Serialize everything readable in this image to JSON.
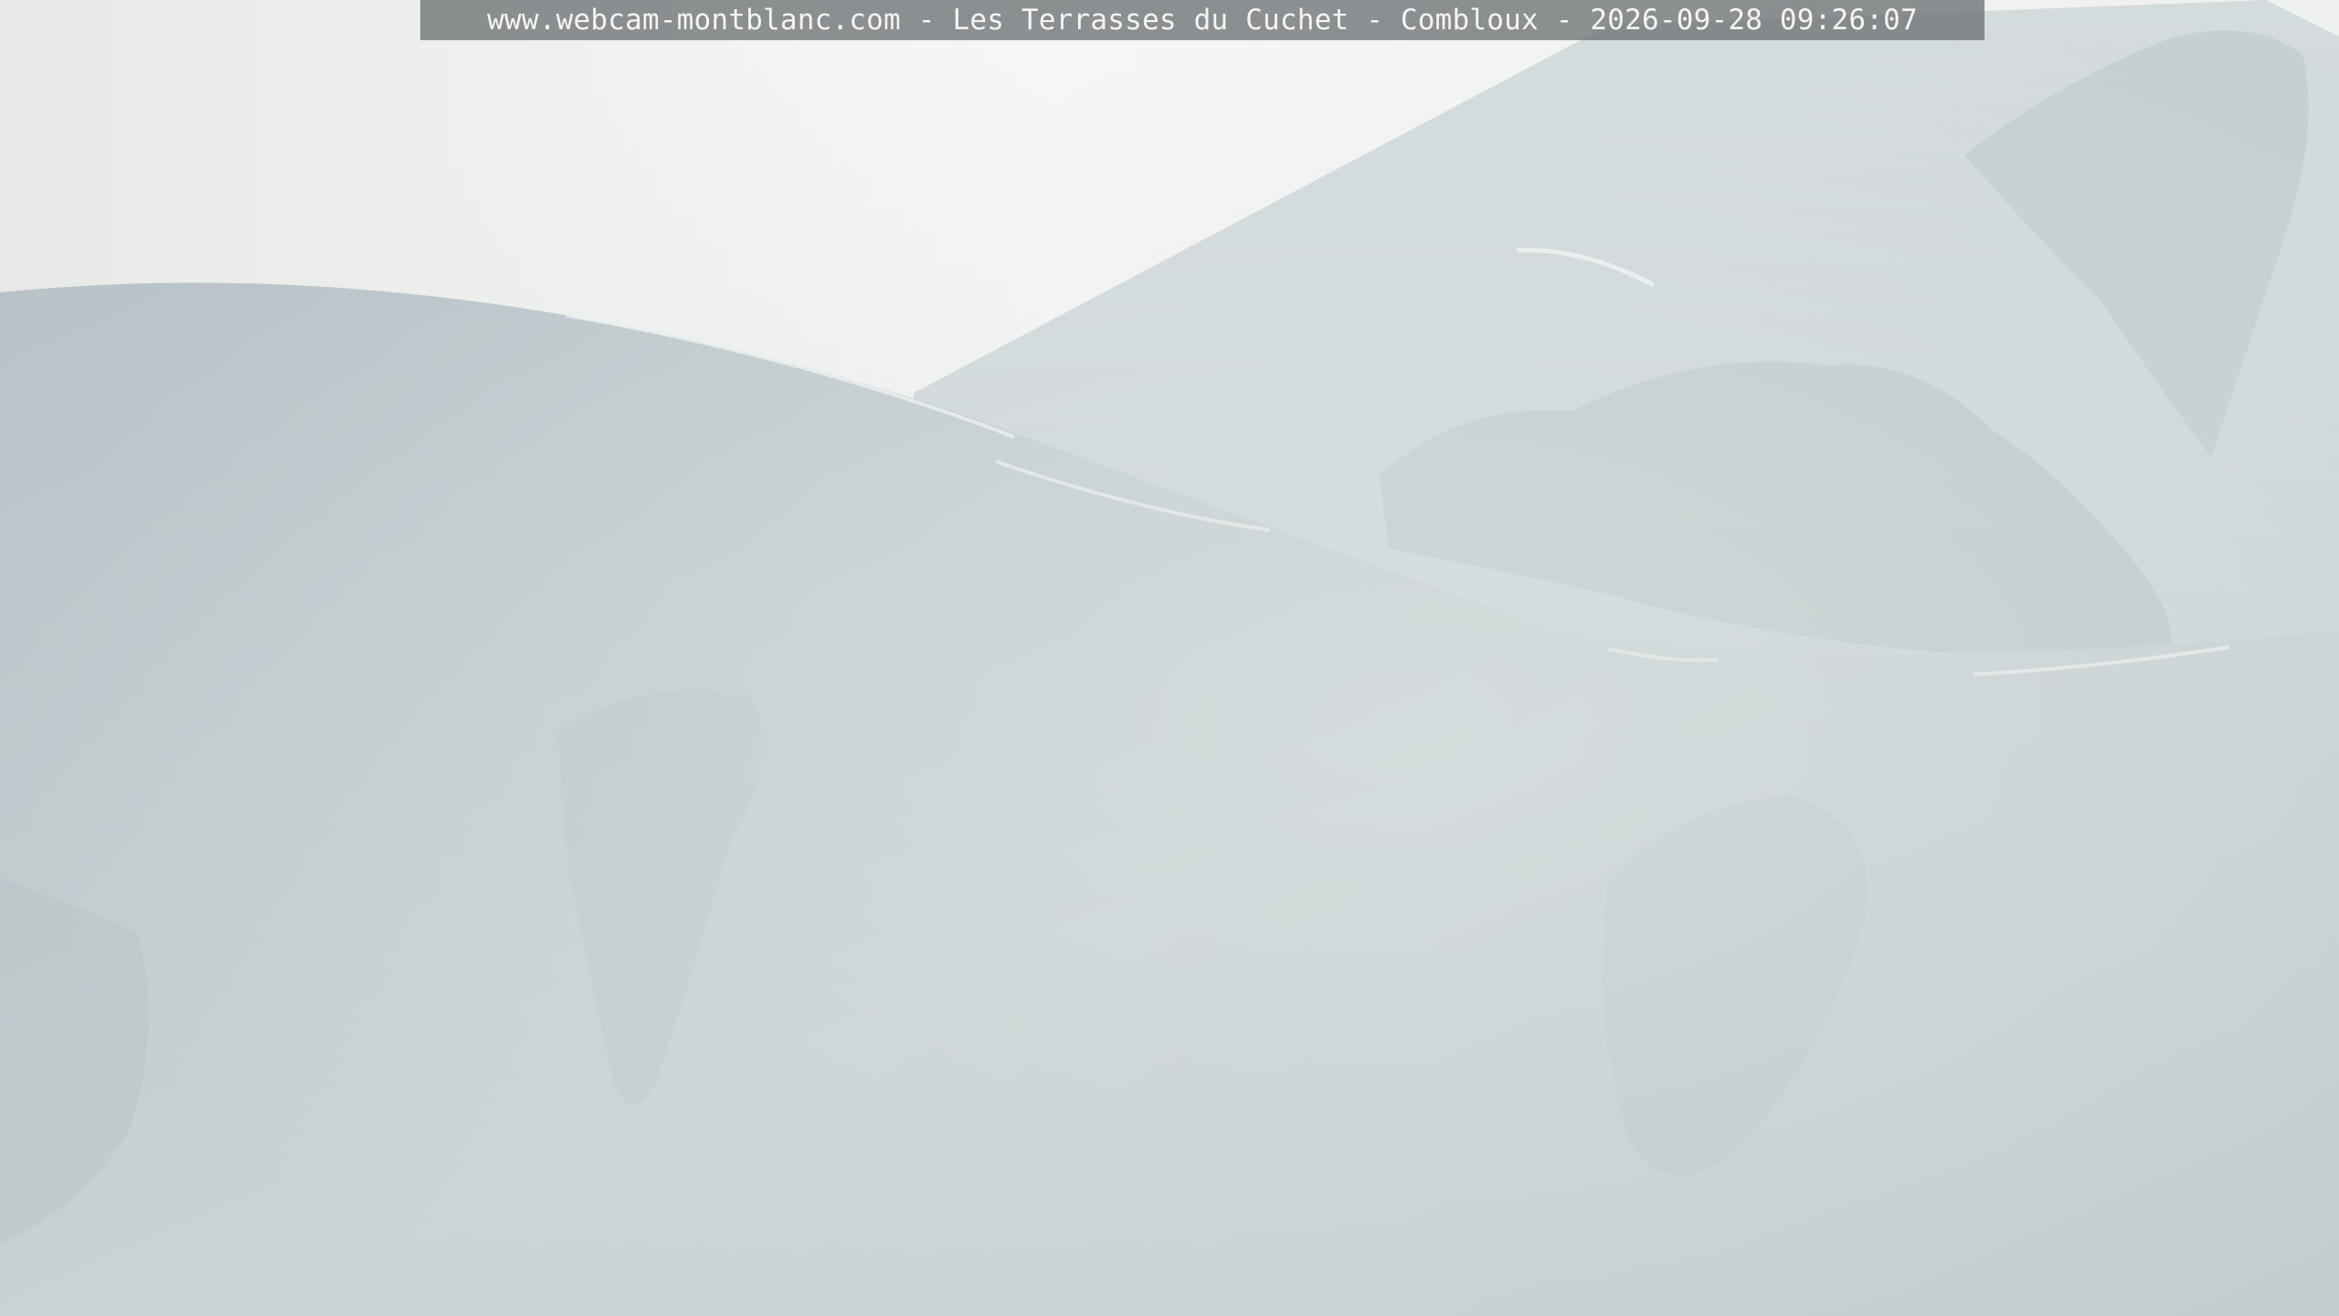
{
  "overlay": {
    "caption": "www.webcam-montblanc.com - Les Terrasses du Cuchet - Combloux - 2026-09-28 09:26:07"
  },
  "colors": {
    "sky": "#f1f2f0",
    "snow_near": "#c3ccd0",
    "snow_far": "#ccd5d7",
    "rock_haze": "#b7c1c3",
    "caption_bg": "#6e7274",
    "caption_text": "#f4f4f4"
  }
}
